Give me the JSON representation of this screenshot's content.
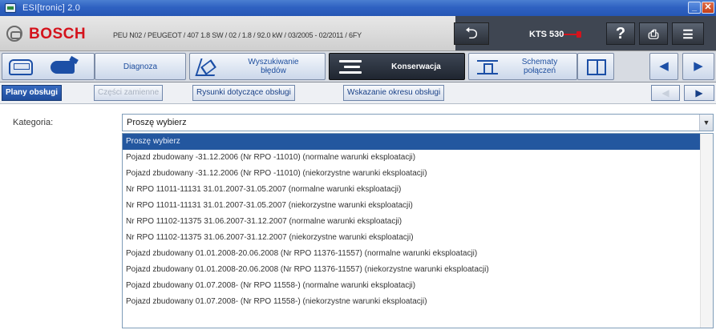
{
  "window": {
    "title": "ESI[tronic] 2.0"
  },
  "header": {
    "brand": "BOSCH",
    "vehicle": "PEU N02 / PEUGEOT / 407 1.8 SW / 02 / 1.8 / 92.0 kW / 03/2005 - 02/2011 / 6FY",
    "kts": "KTS 530",
    "help_icon": "?",
    "back_icon": "back-arrow-icon",
    "print_icon": "printer-icon",
    "menu_icon": "menu-icon"
  },
  "main_nav": {
    "diagnoza": "Diagnoza",
    "wyszukiwanie": "Wyszukiwanie\nbłędów",
    "konserwacja": "Konserwacja",
    "schematy": "Schematy\npołączeń",
    "prev": "◀",
    "next": "▶"
  },
  "sub_nav": {
    "tabs": [
      "Plany obsługi",
      "Części zamienne",
      "Rysunki dotyczące obsługi",
      "Wskazanie okresu obsługi"
    ],
    "prev": "◀",
    "next": "▶"
  },
  "category": {
    "label": "Kategoria:",
    "selected": "Proszę wybierz"
  },
  "options": [
    "Proszę wybierz",
    "Pojazd zbudowany -31.12.2006 (Nr RPO -11010) (normalne warunki eksploatacji)",
    "Pojazd zbudowany -31.12.2006 (Nr RPO -11010) (niekorzystne warunki eksploatacji)",
    "Nr RPO 11011-11131 31.01.2007-31.05.2007 (normalne warunki eksploatacji)",
    "Nr RPO 11011-11131 31.01.2007-31.05.2007 (niekorzystne warunki eksploatacji)",
    "Nr RPO 11102-11375 31.06.2007-31.12.2007 (normalne warunki eksploatacji)",
    "Nr RPO 11102-11375 31.06.2007-31.12.2007 (niekorzystne warunki eksploatacji)",
    "Pojazd zbudowany 01.01.2008-20.06.2008 (Nr RPO 11376-11557) (normalne warunki eksploatacji)",
    "Pojazd zbudowany 01.01.2008-20.06.2008 (Nr RPO 11376-11557) (niekorzystne warunki eksploatacji)",
    "Pojazd zbudowany 01.07.2008- (Nr RPO 11558-) (normalne warunki eksploatacji)",
    "Pojazd zbudowany 01.07.2008- (Nr RPO 11558-) (niekorzystne warunki eksploatacji)"
  ]
}
